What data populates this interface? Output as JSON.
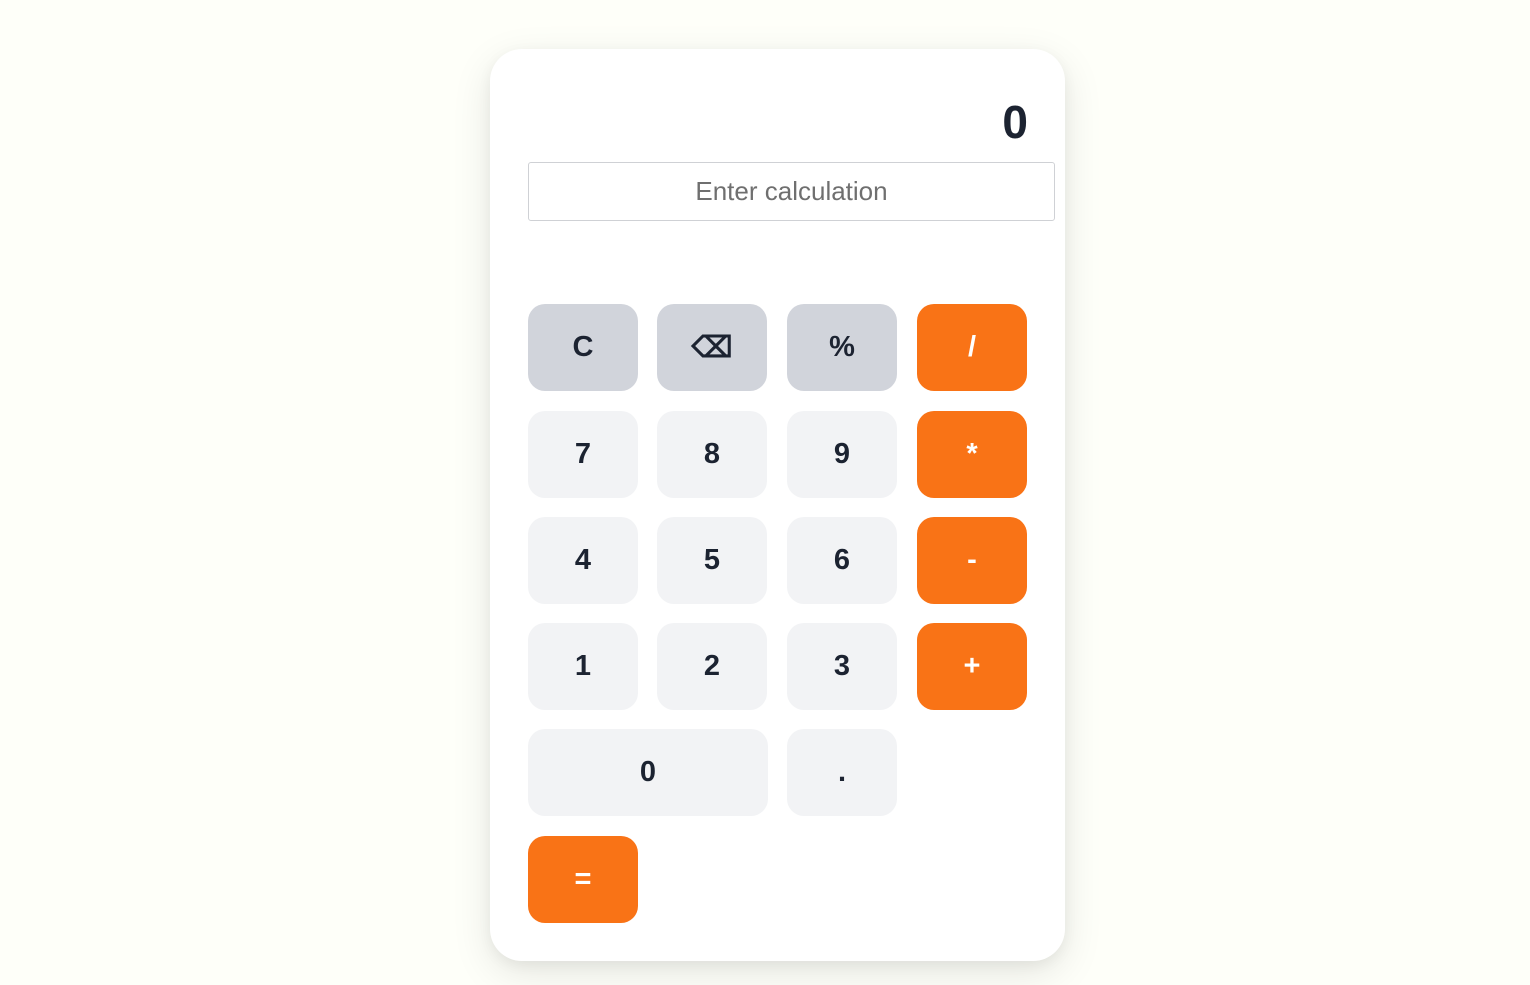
{
  "display": {
    "value": "0"
  },
  "input": {
    "placeholder": "Enter calculation",
    "value": ""
  },
  "keys": {
    "clear": "C",
    "backspace": "⌫",
    "percent": "%",
    "divide": "/",
    "seven": "7",
    "eight": "8",
    "nine": "9",
    "multiply": "*",
    "four": "4",
    "five": "5",
    "six": "6",
    "subtract": "-",
    "one": "1",
    "two": "2",
    "three": "3",
    "add": "+",
    "zero": "0",
    "decimal": ".",
    "equals": "="
  },
  "colors": {
    "page_background": "#fefff9",
    "card_background": "#ffffff",
    "function_key": "#d1d4db",
    "number_key": "#f2f3f5",
    "operator_key": "#f97316",
    "text": "#1c2331"
  }
}
